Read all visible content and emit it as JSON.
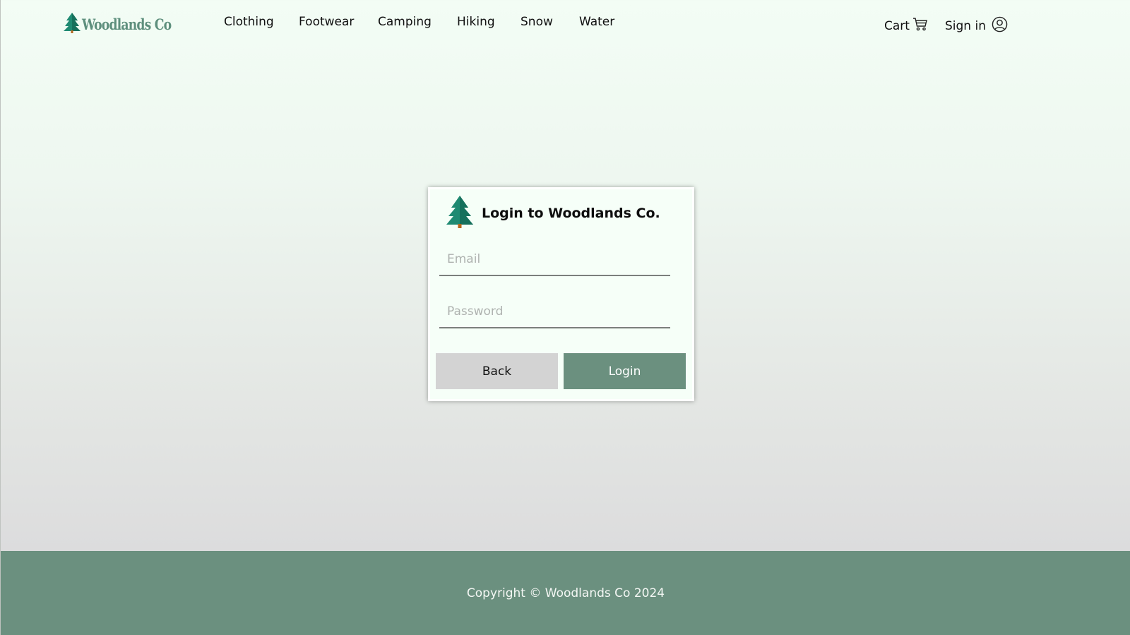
{
  "brand": {
    "name": "Woodlands Co",
    "icon": "pine-tree-icon"
  },
  "nav": {
    "items": [
      {
        "label": "Clothing"
      },
      {
        "label": "Footwear"
      },
      {
        "label": "Camping"
      },
      {
        "label": "Hiking"
      },
      {
        "label": "Snow"
      },
      {
        "label": "Water"
      }
    ]
  },
  "header": {
    "cart_label": "Cart",
    "cart_icon": "shopping-cart-icon",
    "signin_label": "Sign in",
    "signin_icon": "user-circle-icon"
  },
  "login": {
    "title": "Login to Woodlands Co.",
    "email_placeholder": "Email",
    "email_value": "",
    "password_placeholder": "Password",
    "password_value": "",
    "back_label": "Back",
    "login_label": "Login"
  },
  "footer": {
    "copyright": "Copyright © Woodlands Co 2024"
  },
  "colors": {
    "accent": "#6b907f",
    "brand_text": "#5e8f7d",
    "tree_green": "#1f8a72",
    "tree_trunk": "#b5651d",
    "back_button": "#d3d3d3"
  }
}
